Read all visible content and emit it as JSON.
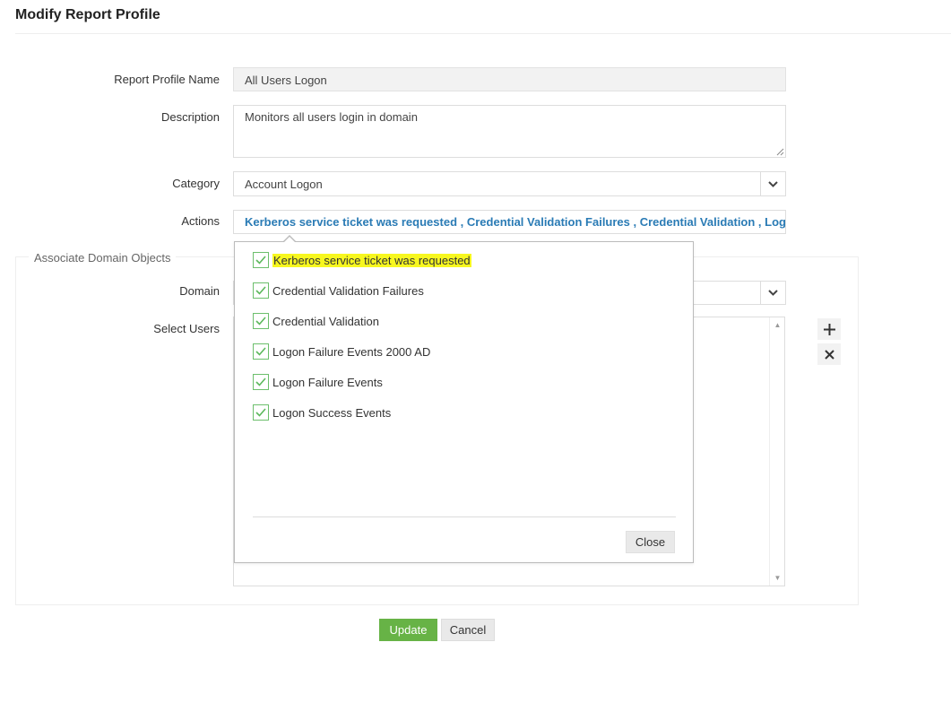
{
  "page": {
    "title": "Modify Report Profile"
  },
  "form": {
    "profile_name": {
      "label": "Report Profile Name",
      "value": "All Users Logon"
    },
    "description": {
      "label": "Description",
      "value": "Monitors all users login in domain"
    },
    "category": {
      "label": "Category",
      "value": "Account Logon"
    },
    "actions": {
      "label": "Actions",
      "value": "Kerberos service ticket was requested , Credential Validation Failures , Credential Validation , Logon ..."
    }
  },
  "associate": {
    "legend": "Associate Domain Objects",
    "domain_label": "Domain",
    "users_label": "Select Users"
  },
  "actions_popup": {
    "options": [
      {
        "label": "Kerberos service ticket was requested",
        "checked": true,
        "highlighted": true
      },
      {
        "label": "Credential Validation Failures",
        "checked": true
      },
      {
        "label": "Credential Validation",
        "checked": true
      },
      {
        "label": "Logon Failure Events 2000 AD",
        "checked": true
      },
      {
        "label": "Logon Failure Events",
        "checked": true
      },
      {
        "label": "Logon Success Events",
        "checked": true
      }
    ],
    "close_label": "Close"
  },
  "buttons": {
    "update": "Update",
    "cancel": "Cancel"
  },
  "colors": {
    "accent_green": "#67b346",
    "link_blue": "#2a7bb5",
    "highlight": "#f7f71f",
    "check_green": "#6cbf6c"
  },
  "icons": {
    "add": "plus-icon",
    "remove": "close-icon",
    "select": "chevron-down-icon",
    "check": "check-icon"
  }
}
